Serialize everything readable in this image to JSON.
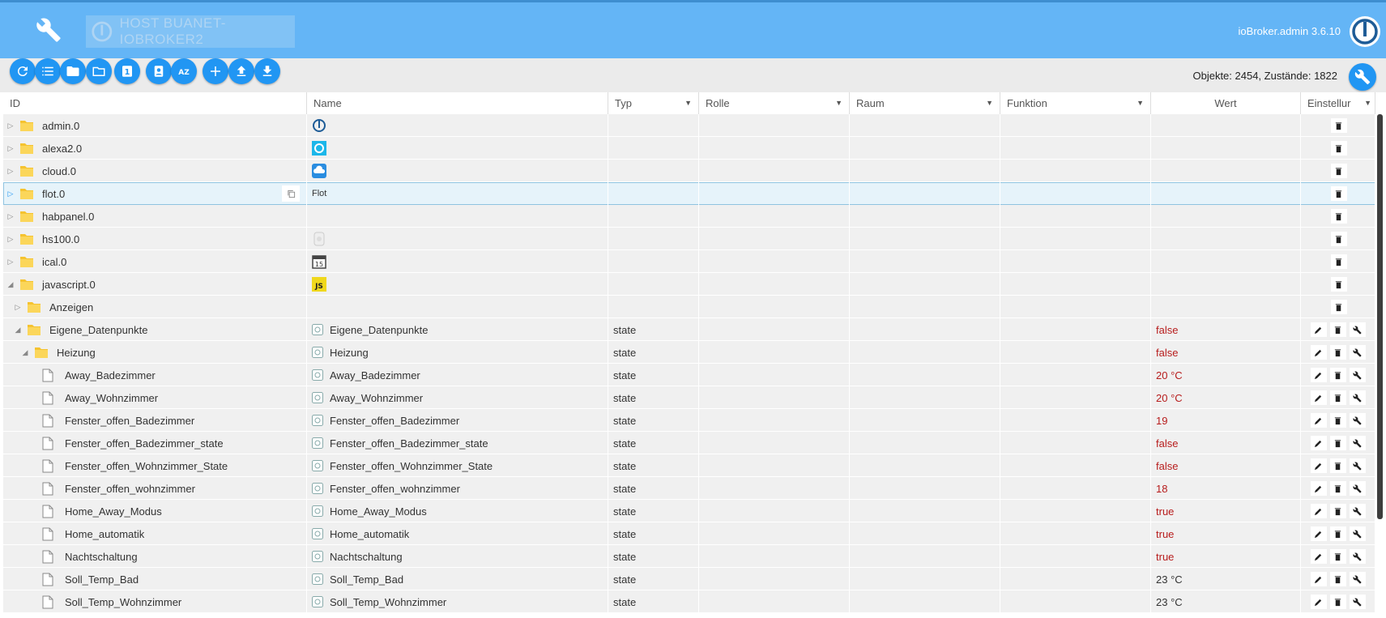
{
  "header": {
    "host_label": "HOST BUANET-IOBROKER2",
    "version": "ioBroker.admin 3.6.10",
    "colors": {
      "bar": "#64b5f6",
      "accent": "#2196f3"
    }
  },
  "toolbar": {
    "buttons": [
      "refresh-icon",
      "list-icon",
      "folder-icon",
      "folder-open-icon",
      "one-icon",
      "contact-icon",
      "sort-az-icon",
      "add-icon",
      "upload-icon",
      "download-icon"
    ],
    "sort_label": "AZ",
    "one_label": "1",
    "counts": "Objekte: 2454, Zustände: 1822"
  },
  "table": {
    "columns": {
      "id": "ID",
      "name": "Name",
      "typ": "Typ",
      "rolle": "Rolle",
      "raum": "Raum",
      "funktion": "Funktion",
      "wert": "Wert",
      "einstellungen": "Einstellur"
    },
    "rows": [
      {
        "id": "admin.0",
        "name": "",
        "typ": "",
        "wert": "",
        "kind": "folder",
        "icon": "iobroker-icon"
      },
      {
        "id": "alexa2.0",
        "name": "",
        "typ": "",
        "wert": "",
        "kind": "folder",
        "icon": "alexa-icon"
      },
      {
        "id": "cloud.0",
        "name": "",
        "typ": "",
        "wert": "",
        "kind": "folder",
        "icon": "cloud-icon"
      },
      {
        "id": "flot.0",
        "name": "Flot",
        "typ": "",
        "wert": "",
        "kind": "folder",
        "selected": true
      },
      {
        "id": "habpanel.0",
        "name": "",
        "typ": "",
        "wert": "",
        "kind": "folder"
      },
      {
        "id": "hs100.0",
        "name": "",
        "typ": "",
        "wert": "",
        "kind": "folder",
        "icon": "plug-icon"
      },
      {
        "id": "ical.0",
        "name": "",
        "typ": "",
        "wert": "",
        "kind": "folder",
        "icon": "calendar-icon",
        "icon_text": "15"
      },
      {
        "id": "javascript.0",
        "name": "",
        "typ": "",
        "wert": "",
        "kind": "folder",
        "expanded": true,
        "icon": "javascript-icon",
        "icon_text": "JS"
      },
      {
        "id": "Anzeigen",
        "name": "",
        "typ": "",
        "wert": "",
        "kind": "folder",
        "depth": 1
      },
      {
        "id": "Eigene_Datenpunkte",
        "name": "Eigene_Datenpunkte",
        "typ": "state",
        "wert": "false",
        "kind": "folder",
        "depth": 1,
        "expanded": true
      },
      {
        "id": "Heizung",
        "name": "Heizung",
        "typ": "state",
        "wert": "false",
        "kind": "folder",
        "depth": 2,
        "expanded": true
      },
      {
        "id": "Away_Badezimmer",
        "name": "Away_Badezimmer",
        "typ": "state",
        "wert": "20 °C",
        "kind": "file"
      },
      {
        "id": "Away_Wohnzimmer",
        "name": "Away_Wohnzimmer",
        "typ": "state",
        "wert": "20 °C",
        "kind": "file"
      },
      {
        "id": "Fenster_offen_Badezimmer",
        "name": "Fenster_offen_Badezimmer",
        "typ": "state",
        "wert": "19",
        "kind": "file"
      },
      {
        "id": "Fenster_offen_Badezimmer_state",
        "name": "Fenster_offen_Badezimmer_state",
        "typ": "state",
        "wert": "false",
        "kind": "file"
      },
      {
        "id": "Fenster_offen_Wohnzimmer_State",
        "name": "Fenster_offen_Wohnzimmer_State",
        "typ": "state",
        "wert": "false",
        "kind": "file"
      },
      {
        "id": "Fenster_offen_wohnzimmer",
        "name": "Fenster_offen_wohnzimmer",
        "typ": "state",
        "wert": "18",
        "kind": "file"
      },
      {
        "id": "Home_Away_Modus",
        "name": "Home_Away_Modus",
        "typ": "state",
        "wert": "true",
        "kind": "file"
      },
      {
        "id": "Home_automatik",
        "name": "Home_automatik",
        "typ": "state",
        "wert": "true",
        "kind": "file"
      },
      {
        "id": "Nachtschaltung",
        "name": "Nachtschaltung",
        "typ": "state",
        "wert": "true",
        "kind": "file"
      },
      {
        "id": "Soll_Temp_Bad",
        "name": "Soll_Temp_Bad",
        "typ": "state",
        "wert": "23 °C",
        "kind": "file",
        "neutral": true
      },
      {
        "id": "Soll_Temp_Wohnzimmer",
        "name": "Soll_Temp_Wohnzimmer",
        "typ": "state",
        "wert": "23 °C",
        "kind": "file",
        "neutral": true
      }
    ]
  }
}
